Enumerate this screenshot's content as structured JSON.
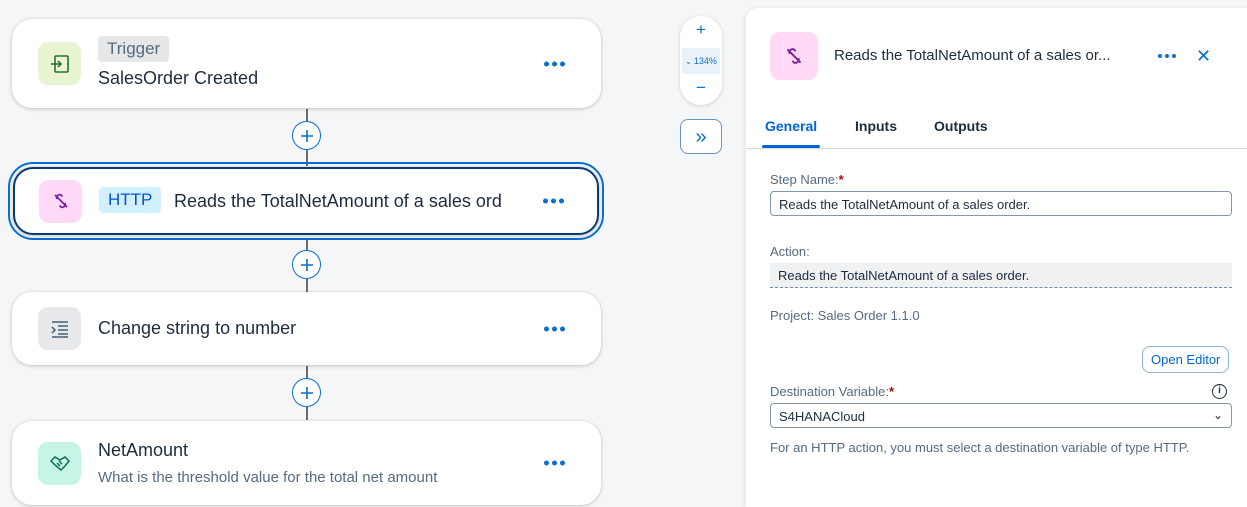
{
  "canvas": {
    "nodes": [
      {
        "tag": "Trigger",
        "title": "SalesOrder Created",
        "icon": "trigger-enter-icon"
      },
      {
        "tag": "HTTP",
        "title": "Reads the TotalNetAmount of a sales ord",
        "icon": "http-link-icon"
      },
      {
        "title": "Change string to number",
        "icon": "indent-script-icon"
      },
      {
        "title": "NetAmount",
        "subtitle": "What is the threshold value for the total net amount",
        "icon": "handshake-icon"
      }
    ],
    "zoom": {
      "plus": "+",
      "minus": "−",
      "level": "134%"
    },
    "expand_label": "»"
  },
  "panel": {
    "title": "Reads the TotalNetAmount of a sales or...",
    "tabs": {
      "general": "General",
      "inputs": "Inputs",
      "outputs": "Outputs"
    },
    "step_name_label": "Step Name:",
    "step_name_value": "Reads the TotalNetAmount of a sales order.",
    "action_label": "Action:",
    "action_value": "Reads the TotalNetAmount of a sales order.",
    "project_text": "Project: Sales Order 1.1.0",
    "open_editor": "Open Editor",
    "destination_label": "Destination Variable:",
    "destination_value": "S4HANACloud",
    "help_text": "For an HTTP action, you must select a destination variable of type HTTP.",
    "required_mark": "*"
  },
  "colors": {
    "accent": "#0a6ed1",
    "trigger_icon_bg": "#e8f4d2",
    "http_icon_bg": "#ffd9f5",
    "script_icon_bg": "#e7e9ec",
    "handshake_icon_bg": "#c6f5e5"
  }
}
